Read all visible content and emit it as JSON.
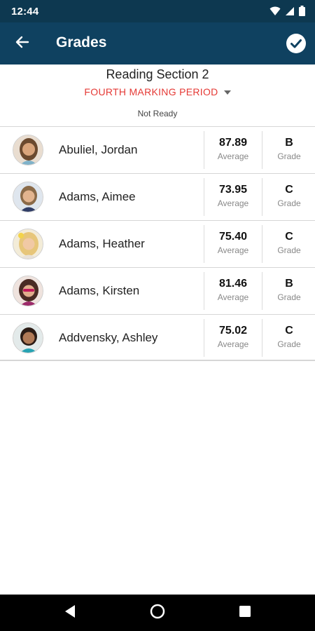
{
  "status_bar": {
    "time": "12:44",
    "wifi_icon": "wifi-icon",
    "signal_icon": "signal-icon",
    "battery_icon": "battery-icon"
  },
  "app_bar": {
    "title": "Grades",
    "back_icon": "arrow-back-icon",
    "done_icon": "check-circle-icon"
  },
  "section": {
    "title": "Reading Section 2",
    "period": "FOURTH MARKING PERIOD",
    "status": "Not Ready"
  },
  "students": [
    {
      "name": "Abuliel, Jordan",
      "average": "87.89",
      "average_caption": "Average",
      "grade": "B",
      "grade_caption": "Grade"
    },
    {
      "name": "Adams, Aimee",
      "average": "73.95",
      "average_caption": "Average",
      "grade": "C",
      "grade_caption": "Grade"
    },
    {
      "name": "Adams, Heather",
      "average": "75.40",
      "average_caption": "Average",
      "grade": "C",
      "grade_caption": "Grade"
    },
    {
      "name": "Adams, Kirsten",
      "average": "81.46",
      "average_caption": "Average",
      "grade": "B",
      "grade_caption": "Grade"
    },
    {
      "name": "Addvensky, Ashley",
      "average": "75.02",
      "average_caption": "Average",
      "grade": "C",
      "grade_caption": "Grade"
    }
  ],
  "colors": {
    "status_bar": "#0d3850",
    "app_bar": "#0f4160",
    "period_accent": "#e53935"
  },
  "nav_bar": {
    "back_icon": "nav-back-icon",
    "home_icon": "nav-home-icon",
    "recents_icon": "nav-recents-icon"
  }
}
